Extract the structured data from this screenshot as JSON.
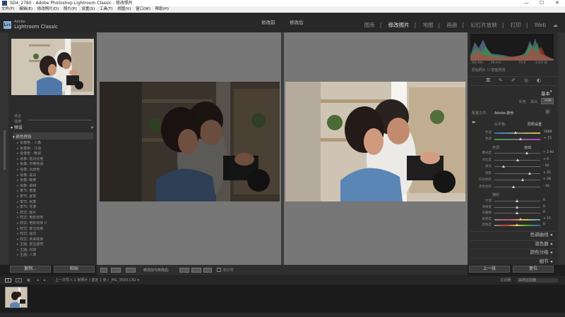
{
  "window": {
    "title": "SD4_2780 - Adobe Photoshop Lightroom Classic - 修改照片",
    "controls": [
      "—",
      "☐",
      "✕"
    ]
  },
  "menubar": [
    "文件(F)",
    "编辑(E)",
    "修改照片(D)",
    "照片(P)",
    "设置(S)",
    "工具(T)",
    "视图(V)",
    "窗口(W)",
    "帮助(H)"
  ],
  "identity": {
    "line1": "Adobe",
    "line2": "Lightroom Classic",
    "logo": "Lrc"
  },
  "modules": [
    {
      "label": "图库",
      "active": false
    },
    {
      "label": "修改照片",
      "active": true
    },
    {
      "label": "地图",
      "active": false
    },
    {
      "label": "画册",
      "active": false
    },
    {
      "label": "幻灯片放映",
      "active": false
    },
    {
      "label": "打印",
      "active": false
    },
    {
      "label": "Web",
      "active": false
    }
  ],
  "view": {
    "before_label": "修改前",
    "after_label": "修改后"
  },
  "left": {
    "nav_zoom": [
      "适合",
      "填满"
    ],
    "presets_title": "预设",
    "group_label": "▾ 颜色预设",
    "presets": [
      "肖像色 - 人像",
      "肖像色 - 冷调",
      "肖像色 - 暖调",
      "肖像: 低对比度",
      "肖像: 中等色调",
      "肖像: 风景色",
      "肖像: 黑白",
      "肖像: 暖黄",
      "肖像: 柔和",
      "季节: 春季",
      "季节: 夏季",
      "季节: 秋季",
      "季节: 冬季",
      "样式: 胶片",
      "样式: 电影效果",
      "样式: 电影效果 II",
      "样式: 复古效果",
      "样式: 强烈",
      "样式: 未来效果",
      "主题: 复古建筑",
      "主题: 风景",
      "主题: 人像"
    ],
    "buttons": {
      "copy": "复制...",
      "paste": "粘贴"
    }
  },
  "toolbar": {
    "mode": "修改前与修改后:",
    "soft_proof": "软打样"
  },
  "right": {
    "hist_text": "原始照片 ☐ 智能预览",
    "histogram_readout": [
      "ISO 400",
      "38 mm",
      "f/2.8",
      "1/125 秒"
    ],
    "panel": "基本",
    "treatment": [
      "彩色",
      "黑白",
      "HDR"
    ],
    "profile_label": "配置文件:",
    "profile": "Adobe 颜色",
    "wb_label": "白平衡:",
    "wb_value": "原照设置",
    "color_temp": {
      "label": "色温",
      "value": "5000"
    },
    "tint": {
      "label": "色调",
      "value": "+ 15"
    },
    "tone_label": "色调",
    "auto_label": "自动",
    "tone": [
      {
        "label": "曝光度",
        "value": "+ 2.93",
        "pos": 0.72
      },
      {
        "label": "对比度",
        "value": "+ 6",
        "pos": 0.52
      },
      {
        "label": "高光",
        "value": "- 62",
        "pos": 0.2
      },
      {
        "label": "阴影",
        "value": "+ 55",
        "pos": 0.78
      },
      {
        "label": "白色色阶",
        "value": "+ 28",
        "pos": 0.62
      },
      {
        "label": "黑色色阶",
        "value": "- 16",
        "pos": 0.42
      }
    ],
    "presence_label": "偏好",
    "presence": [
      {
        "label": "纹理",
        "value": "0",
        "pos": 0.5
      },
      {
        "label": "清晰度",
        "value": "0",
        "pos": 0.5
      },
      {
        "label": "去朦胧",
        "value": "0",
        "pos": 0.5
      },
      {
        "label": "鲜艳度",
        "value": "+ 15",
        "pos": 0.57
      },
      {
        "label": "饱和度",
        "value": "0",
        "pos": 0.5
      }
    ],
    "panels": [
      "色调曲线 ◂",
      "混色器 ◂",
      "颜色分级 ◂",
      "细节 ◂"
    ],
    "buttons": {
      "prev": "上一张",
      "reset": "复位"
    }
  },
  "filmstrip": {
    "pages": [
      "1",
      "2"
    ],
    "path": "上一次导入  1 张照片 / 选定 1 张 / _MG_3593.CR2 ▾",
    "filter_label": "过滤器:",
    "filter_value": "关闭过滤器"
  }
}
